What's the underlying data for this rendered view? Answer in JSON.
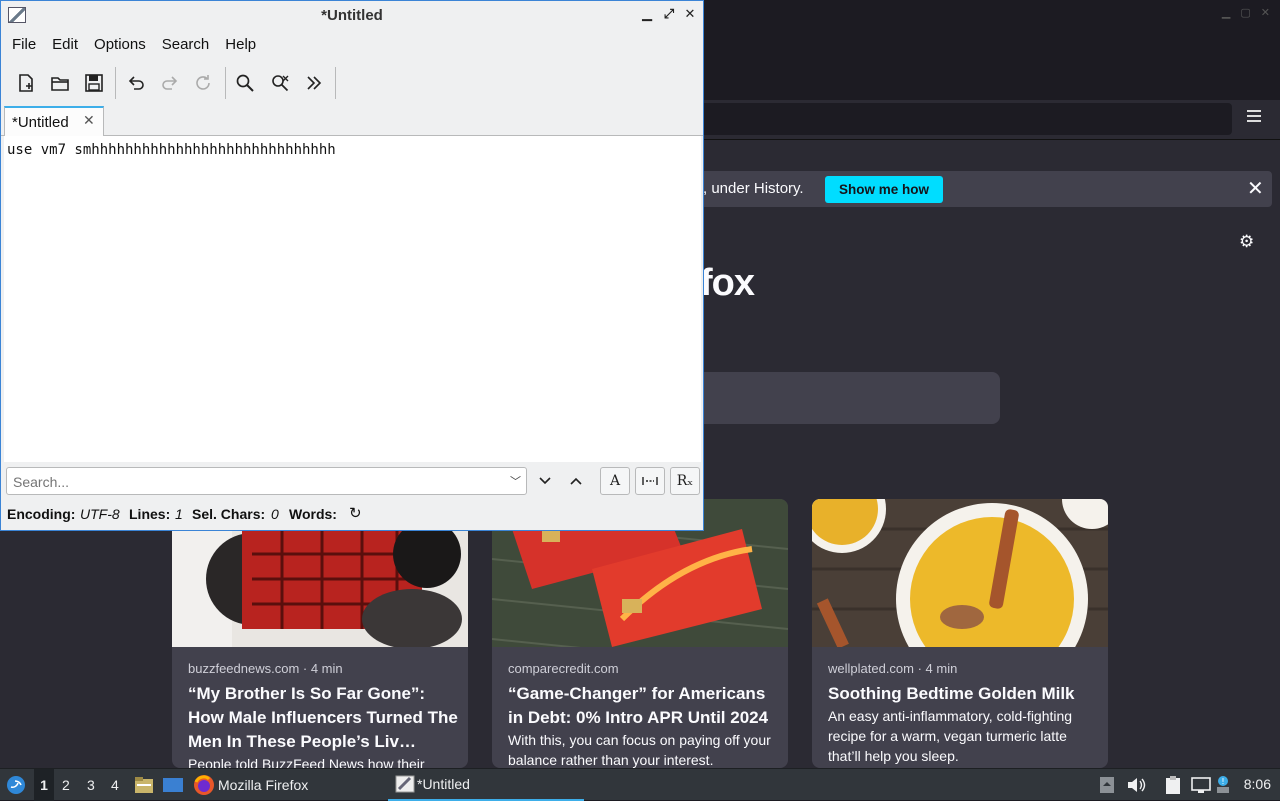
{
  "firefox": {
    "notice_text": ", under History.",
    "notice_button": "Show me how",
    "logo_text": "fox",
    "cards": [
      {
        "source": "buzzfeednews.com · 4 min",
        "title": "“My Brother Is So Far Gone”: How Male Influencers Turned The Men In These People’s Liv…",
        "excerpt": "People told BuzzFeed News how their"
      },
      {
        "source": "comparecredit.com",
        "title": "“Game-Changer” for Americans in Debt: 0% Intro APR Until 2024",
        "excerpt": "With this, you can focus on paying off your balance rather than your interest."
      },
      {
        "source": "wellplated.com · 4 min",
        "title": "Soothing Bedtime Golden Milk",
        "excerpt": "An easy anti-inflammatory, cold-fighting recipe for a warm, vegan turmeric latte that’ll help you sleep."
      }
    ]
  },
  "editor": {
    "window_title": "*Untitled",
    "menu": [
      "File",
      "Edit",
      "Options",
      "Search",
      "Help"
    ],
    "tab_label": "*Untitled",
    "text": "use vm7 smhhhhhhhhhhhhhhhhhhhhhhhhhhhhh",
    "search_placeholder": "Search...",
    "status": {
      "encoding_label": "Encoding:",
      "encoding_value": "UTF-8",
      "lines_label": "Lines:",
      "lines_value": "1",
      "selchars_label": "Sel. Chars:",
      "selchars_value": "0",
      "words_label": "Words:"
    },
    "toolbar_icons": [
      "new-file-icon",
      "open-folder-icon",
      "save-icon",
      "undo-icon",
      "redo-icon",
      "reload-icon",
      "find-icon",
      "find-replace-icon",
      "more-icon"
    ]
  },
  "taskbar": {
    "desktops": [
      "1",
      "2",
      "3",
      "4"
    ],
    "firefox_label": "Mozilla Firefox",
    "editor_label": "*Untitled",
    "clock": "8:06"
  },
  "colors": {
    "accent": "#3daee9",
    "firefox_button": "#00ddff"
  }
}
